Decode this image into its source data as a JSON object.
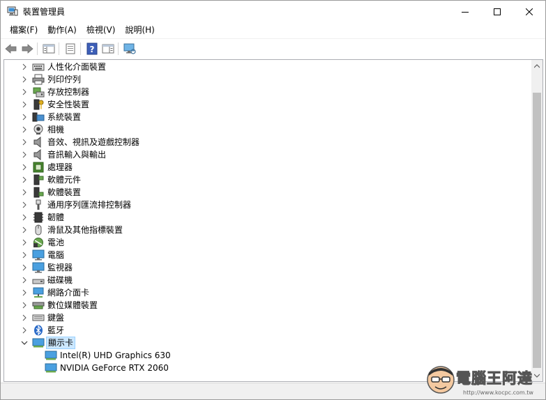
{
  "window": {
    "title": "裝置管理員",
    "controls": {
      "minimize": "minimize-icon",
      "maximize": "maximize-icon",
      "close": "close-icon"
    }
  },
  "menu": [
    {
      "label": "檔案(F)"
    },
    {
      "label": "動作(A)"
    },
    {
      "label": "檢視(V)"
    },
    {
      "label": "說明(H)"
    }
  ],
  "toolbar": [
    {
      "icon": "back-arrow-icon"
    },
    {
      "icon": "forward-arrow-icon"
    },
    {
      "icon": "show-hide-tree-icon"
    },
    {
      "icon": "properties-icon"
    },
    {
      "icon": "help-icon"
    },
    {
      "icon": "action-pane-icon"
    },
    {
      "icon": "monitor-scan-icon"
    }
  ],
  "tree": {
    "categories": [
      {
        "label": "人性化介面裝置",
        "icon": "hid-icon"
      },
      {
        "label": "列印佇列",
        "icon": "printer-icon"
      },
      {
        "label": "存放控制器",
        "icon": "storage-controller-icon"
      },
      {
        "label": "安全性裝置",
        "icon": "security-device-icon"
      },
      {
        "label": "系統裝置",
        "icon": "system-device-icon"
      },
      {
        "label": "相機",
        "icon": "camera-icon"
      },
      {
        "label": "音效、視訊及遊戲控制器",
        "icon": "speaker-icon"
      },
      {
        "label": "音訊輸入與輸出",
        "icon": "audio-io-icon"
      },
      {
        "label": "處理器",
        "icon": "processor-icon"
      },
      {
        "label": "軟體元件",
        "icon": "software-component-icon"
      },
      {
        "label": "軟體裝置",
        "icon": "software-device-icon"
      },
      {
        "label": "通用序列匯流排控制器",
        "icon": "usb-icon"
      },
      {
        "label": "韌體",
        "icon": "firmware-icon"
      },
      {
        "label": "滑鼠及其他指標裝置",
        "icon": "mouse-icon"
      },
      {
        "label": "電池",
        "icon": "battery-icon"
      },
      {
        "label": "電腦",
        "icon": "computer-icon"
      },
      {
        "label": "監視器",
        "icon": "monitor-icon"
      },
      {
        "label": "磁碟機",
        "icon": "disk-drive-icon"
      },
      {
        "label": "網路介面卡",
        "icon": "network-adapter-icon"
      },
      {
        "label": "數位媒體裝置",
        "icon": "digital-media-icon"
      },
      {
        "label": "鍵盤",
        "icon": "keyboard-icon"
      },
      {
        "label": "藍牙",
        "icon": "bluetooth-icon"
      }
    ],
    "expanded": {
      "label": "顯示卡",
      "icon": "display-adapter-icon",
      "children": [
        {
          "label": "Intel(R) UHD Graphics 630",
          "icon": "display-adapter-icon"
        },
        {
          "label": "NVIDIA GeForce RTX 2060",
          "icon": "display-adapter-icon"
        }
      ]
    }
  },
  "watermark": {
    "text": "電腦王阿達",
    "url": "http://www.kocpc.com.tw"
  },
  "colors": {
    "selection_bg": "#cce8ff",
    "selection_border": "#99d1ff",
    "accent_blue": "#2a78c8"
  }
}
